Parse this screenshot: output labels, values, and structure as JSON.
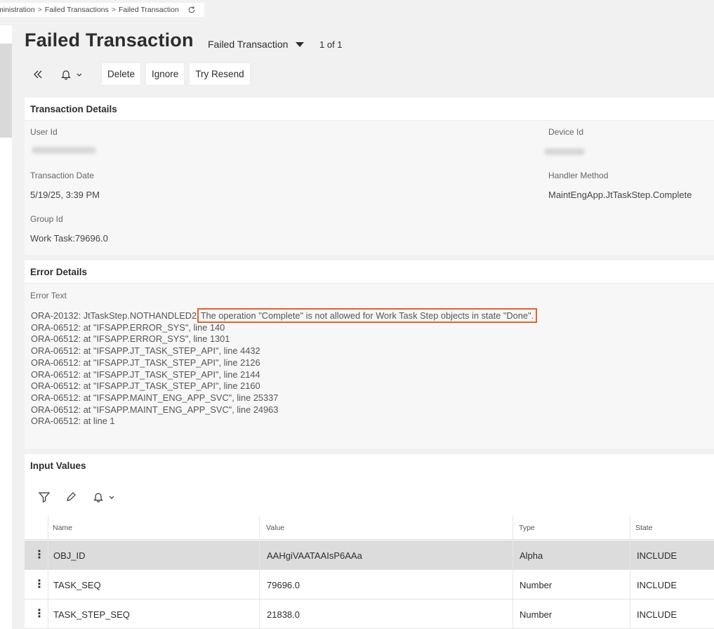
{
  "breadcrumb": {
    "items": [
      "ministration",
      "Failed Transactions",
      "Failed Transaction"
    ],
    "separator": ">"
  },
  "header": {
    "title": "Failed Transaction",
    "record_selector": "Failed Transaction",
    "record_count": "1 of 1"
  },
  "toolbar": {
    "delete_label": "Delete",
    "ignore_label": "Ignore",
    "resend_label": "Try Resend"
  },
  "transaction_details": {
    "title": "Transaction Details",
    "user_id_label": "User Id",
    "device_id_label": "Device Id",
    "transaction_date_label": "Transaction Date",
    "transaction_date": "5/19/25, 3:39 PM",
    "handler_method_label": "Handler Method",
    "handler_method": "MaintEngApp.JtTaskStep.Complete",
    "group_id_label": "Group Id",
    "group_id": "Work Task:79696.0"
  },
  "error_details": {
    "title": "Error Details",
    "error_text_label": "Error Text",
    "first_line_prefix": "ORA-20132: JtTaskStep.NOTHANDLED2:",
    "first_line_highlight": "The operation \"Complete\" is not allowed for Work Task Step objects in state \"Done\".",
    "lines": [
      "ORA-06512: at \"IFSAPP.ERROR_SYS\", line 140",
      "ORA-06512: at \"IFSAPP.ERROR_SYS\", line 1301",
      "ORA-06512: at \"IFSAPP.JT_TASK_STEP_API\", line 4432",
      "ORA-06512: at \"IFSAPP.JT_TASK_STEP_API\", line 2126",
      "ORA-06512: at \"IFSAPP.JT_TASK_STEP_API\", line 2144",
      "ORA-06512: at \"IFSAPP.JT_TASK_STEP_API\", line 2160",
      "ORA-06512: at \"IFSAPP.MAINT_ENG_APP_SVC\", line 25337",
      "ORA-06512: at \"IFSAPP.MAINT_ENG_APP_SVC\", line 24963",
      "ORA-06512: at line 1"
    ],
    "highlight_color": "#e5632c"
  },
  "input_values": {
    "title": "Input Values",
    "columns": [
      "Name",
      "Value",
      "Type",
      "State"
    ],
    "rows": [
      {
        "name": "OBJ_ID",
        "value": "AAHgiVAATAAIsP6AAa",
        "type": "Alpha",
        "state": "INCLUDE"
      },
      {
        "name": "TASK_SEQ",
        "value": "79696.0",
        "type": "Number",
        "state": "INCLUDE"
      },
      {
        "name": "TASK_STEP_SEQ",
        "value": "21838.0",
        "type": "Number",
        "state": "INCLUDE"
      }
    ]
  },
  "icons": {
    "refresh": "refresh-icon",
    "collapse": "double-chevron-left-icon",
    "bell": "bell-icon",
    "filter": "filter-icon",
    "edit": "pencil-icon",
    "kebab": "kebab-menu-icon"
  }
}
